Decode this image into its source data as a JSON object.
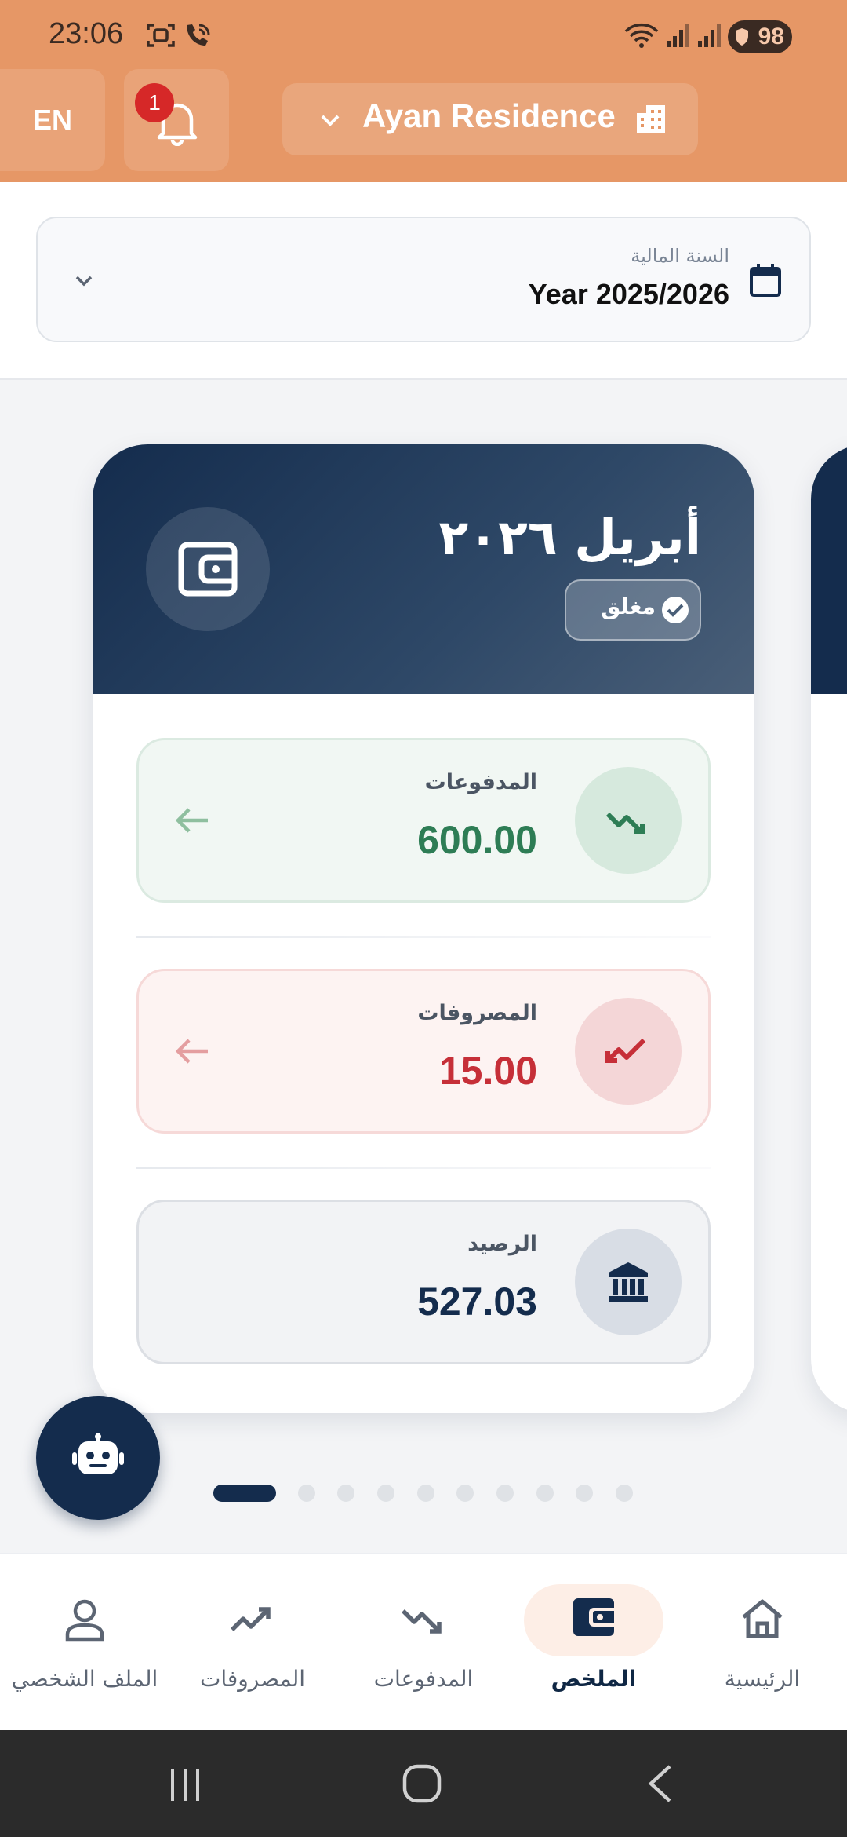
{
  "status_bar": {
    "time": "23:06",
    "battery": "98"
  },
  "header": {
    "language_button": "EN",
    "notification_count": "1",
    "property_name": "Ayan Residence"
  },
  "fiscal_year": {
    "label": "السنة المالية",
    "value": "Year 2025/2026"
  },
  "month_card": {
    "title": "أبريل ٢٠٢٦",
    "status_badge": "مغلق",
    "payments": {
      "label": "المدفوعات",
      "value": "600.00",
      "color": "#2e7d55"
    },
    "expenses": {
      "label": "المصروفات",
      "value": "15.00",
      "color": "#c62f38"
    },
    "balance": {
      "label": "الرصيد",
      "value": "527.03",
      "color": "#142c4d"
    }
  },
  "pager": {
    "total": 10,
    "active_index": 0
  },
  "bottom_nav": {
    "items": [
      {
        "label": "الملف الشخصي",
        "icon": "person-icon"
      },
      {
        "label": "المصروفات",
        "icon": "trend-down-icon"
      },
      {
        "label": "المدفوعات",
        "icon": "trend-up-icon"
      },
      {
        "label": "الملخص",
        "icon": "wallet-icon",
        "active": true
      },
      {
        "label": "الرئيسية",
        "icon": "home-icon"
      }
    ]
  },
  "colors": {
    "header": "#e69766",
    "navy": "#142c4d",
    "payments_bg": "#f1f7f3",
    "expenses_bg": "#fdf3f2",
    "balance_bg": "#f2f3f5"
  }
}
